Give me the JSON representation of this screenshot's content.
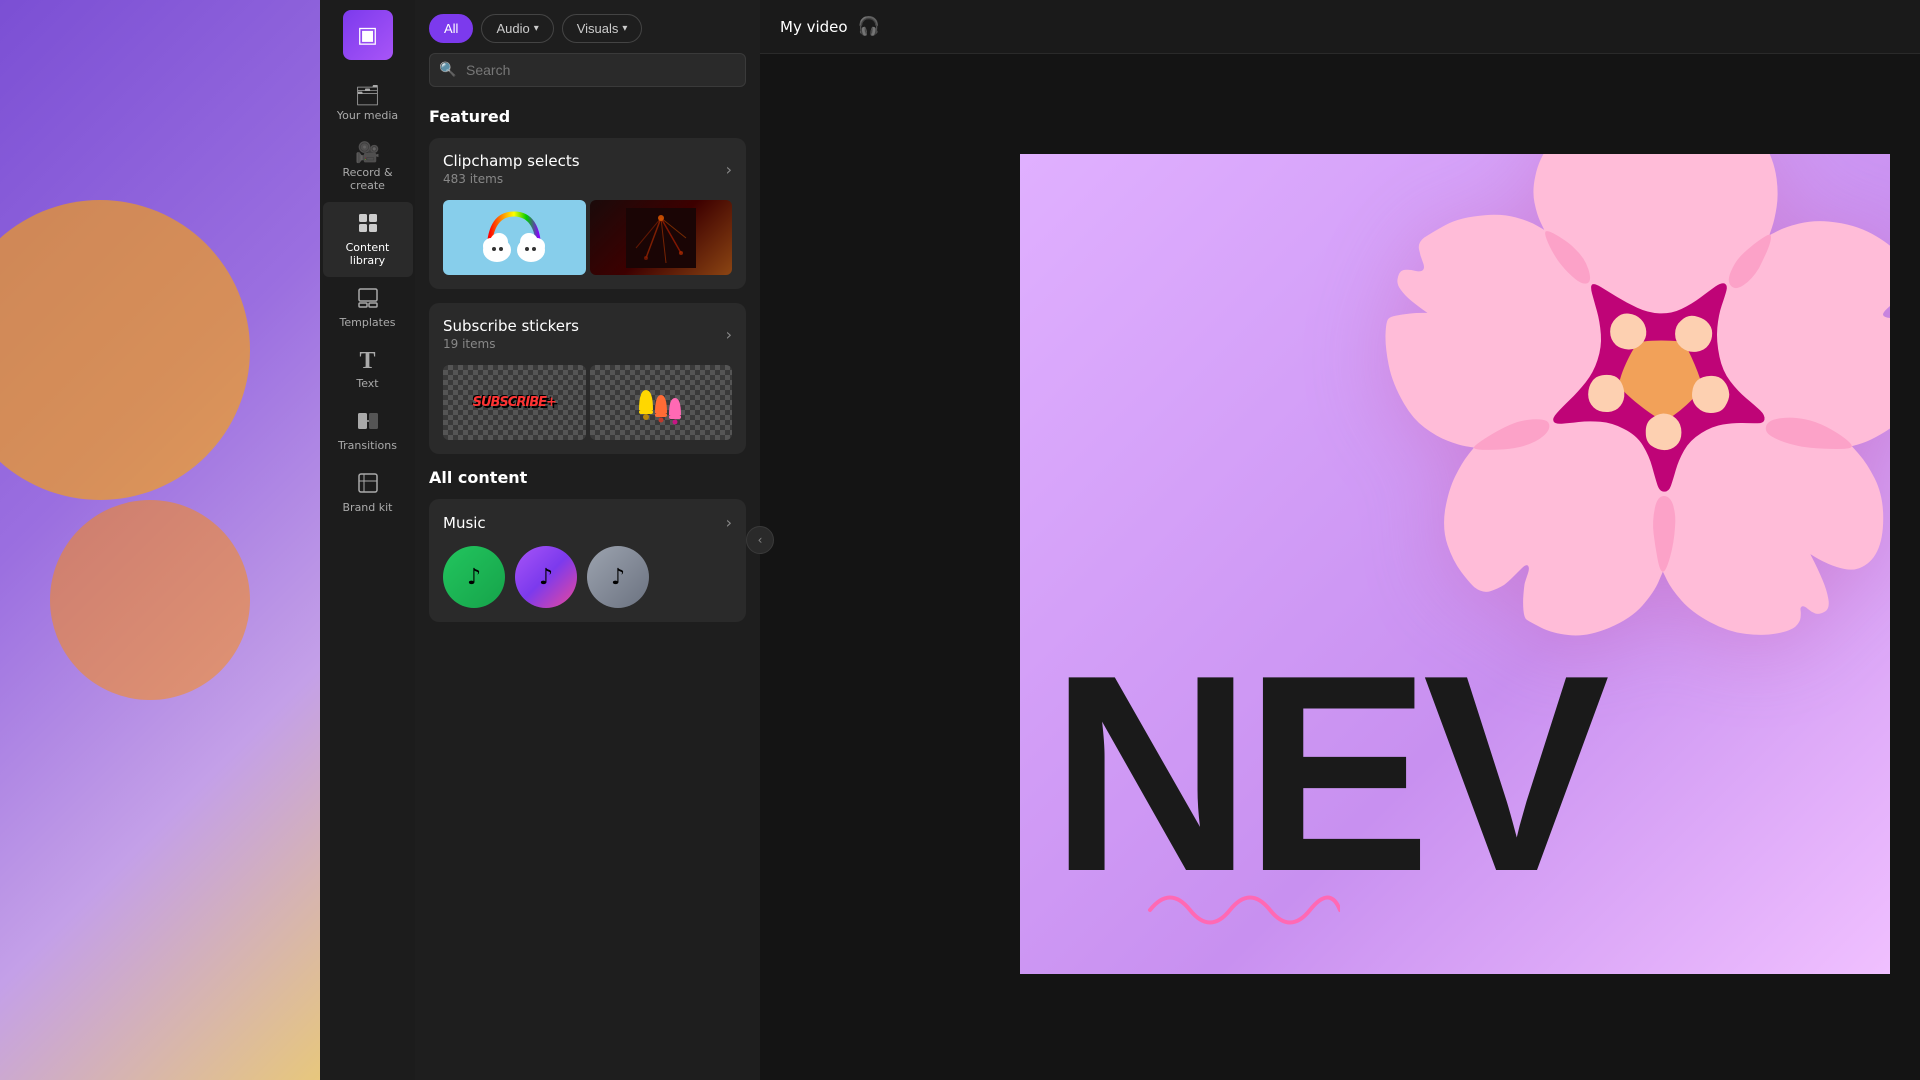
{
  "app": {
    "logo_icon": "▣",
    "title": "My video"
  },
  "sidebar": {
    "items": [
      {
        "id": "your-media",
        "label": "Your media",
        "icon": "🗂"
      },
      {
        "id": "record-create",
        "label": "Record &\ncreate",
        "icon": "🎥"
      },
      {
        "id": "content-library",
        "label": "Content\nlibrary",
        "icon": "🗃"
      },
      {
        "id": "templates",
        "label": "Templates",
        "icon": "🔲"
      },
      {
        "id": "text",
        "label": "Text",
        "icon": "T"
      },
      {
        "id": "transitions",
        "label": "Transitions",
        "icon": "⊞"
      },
      {
        "id": "brand-kit",
        "label": "Brand kit",
        "icon": "🏷"
      }
    ],
    "active": "content-library"
  },
  "filters": {
    "buttons": [
      {
        "id": "all",
        "label": "All",
        "active": true
      },
      {
        "id": "audio",
        "label": "Audio",
        "has_dropdown": true
      },
      {
        "id": "visuals",
        "label": "Visuals",
        "has_dropdown": true
      }
    ]
  },
  "search": {
    "placeholder": "Search"
  },
  "content": {
    "featured_title": "Featured",
    "categories": [
      {
        "id": "clipchamp-selects",
        "title": "Clipchamp selects",
        "count": "483 items",
        "thumbs": [
          "rainbow-cloud",
          "dark-sparkle"
        ]
      },
      {
        "id": "subscribe-stickers",
        "title": "Subscribe stickers",
        "count": "19 items",
        "thumbs": [
          "subscribe-text",
          "bells"
        ]
      }
    ],
    "all_content_title": "All content",
    "music_section": {
      "title": "Music",
      "circles": [
        {
          "id": "music-green",
          "style": "green",
          "icon": "♪"
        },
        {
          "id": "music-purple",
          "style": "purple",
          "icon": "♪"
        },
        {
          "id": "music-gray",
          "style": "gray",
          "icon": "♪"
        }
      ]
    }
  },
  "preview": {
    "title": "My video",
    "flower_emoji": "🌸",
    "text_preview": "NEV"
  }
}
